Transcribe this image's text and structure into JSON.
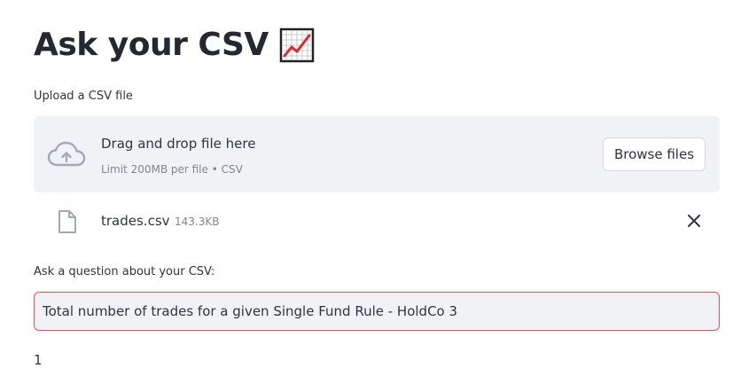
{
  "header": {
    "title": "Ask your CSV",
    "title_emoji": "chart-increasing-icon"
  },
  "uploader": {
    "label": "Upload a CSV file",
    "dropzone_text": "Drag and drop file here",
    "limit_text": "Limit 200MB per file • CSV",
    "browse_label": "Browse files",
    "file": {
      "name": "trades.csv",
      "size": "143.3KB"
    }
  },
  "question": {
    "label": "Ask a question about your CSV:",
    "value": "Total number of trades for a given Single Fund Rule - HoldCo 3"
  },
  "answer": {
    "text": "1"
  },
  "colors": {
    "accent": "#ff4b4b",
    "dropzone_bg": "#f0f2f6",
    "text": "#31333f",
    "muted": "#808495"
  }
}
